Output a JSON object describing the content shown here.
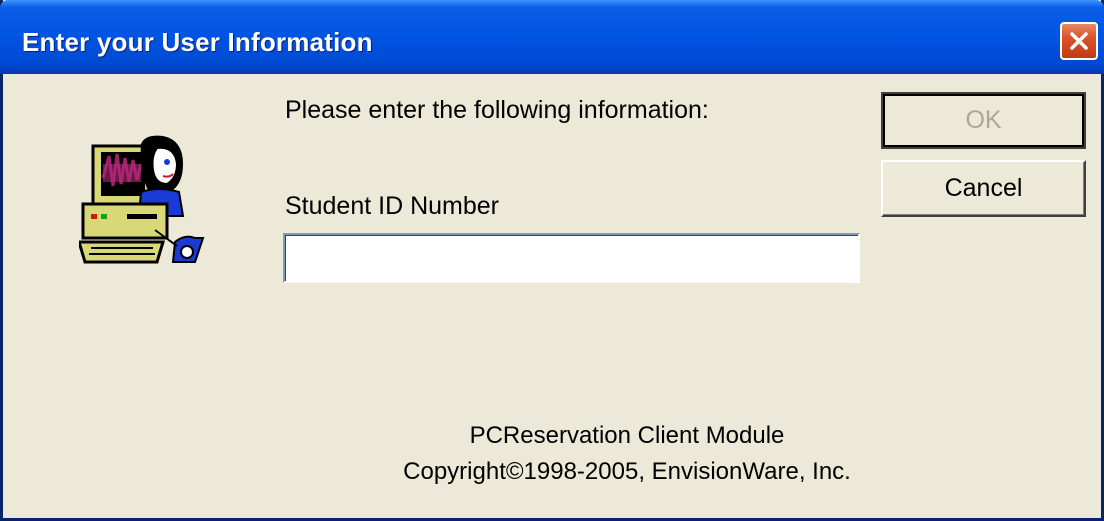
{
  "window": {
    "title": "Enter your User Information",
    "close_icon": "close-x-icon"
  },
  "dialog": {
    "prompt": "Please enter the following information:",
    "field_label": "Student ID Number",
    "field_value": "",
    "app_icon": "computer-user-icon"
  },
  "buttons": {
    "ok_label": "OK",
    "ok_enabled": false,
    "cancel_label": "Cancel"
  },
  "footer": {
    "product": "PCReservation Client Module",
    "copyright": "Copyright©1998-2005, EnvisionWare, Inc."
  },
  "colors": {
    "titlebar": "#0054e3",
    "dialog_bg": "#ece9d8",
    "close_button": "#d9542b",
    "disabled_text": "#aca899"
  }
}
